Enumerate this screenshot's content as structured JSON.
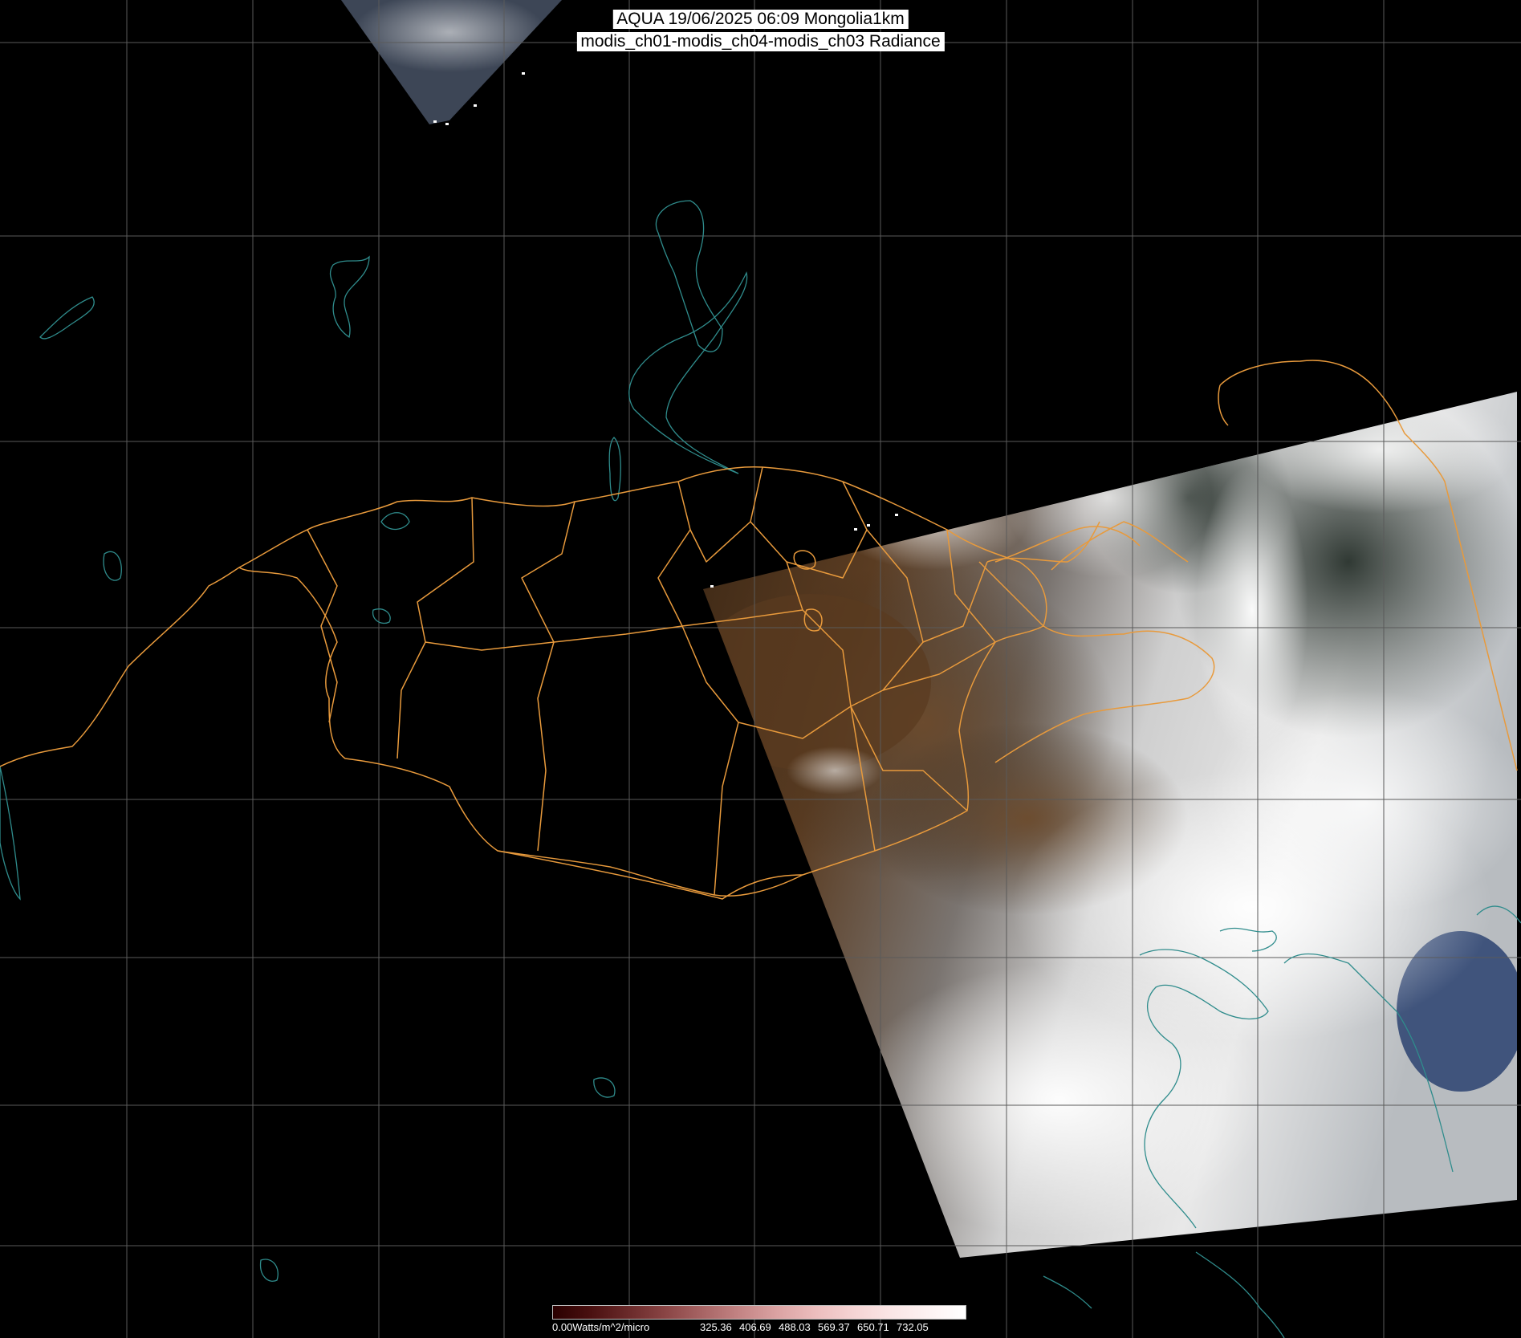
{
  "title": {
    "line1": "AQUA 19/06/2025 06:09 Mongolia1km",
    "line2": "modis_ch01-modis_ch04-modis_ch03 Radiance"
  },
  "legend": {
    "min_label": "0.00Watts/m^2/micro",
    "ticks": [
      "325.36",
      "406.69",
      "488.03",
      "569.37",
      "650.71",
      "732.05"
    ],
    "colors": [
      "#2a0000",
      "#4a1010",
      "#6a2a2a",
      "#8a4545",
      "#a86565",
      "#c48585",
      "#dba3a3",
      "#ecbdbd",
      "#f5d3d3",
      "#fae5e5",
      "#fdf2f2",
      "#ffffff"
    ]
  },
  "colors": {
    "grid": "#5a5a5a",
    "borders": "#e89a3c",
    "coast": "#2f8c8c",
    "background": "#000000"
  }
}
